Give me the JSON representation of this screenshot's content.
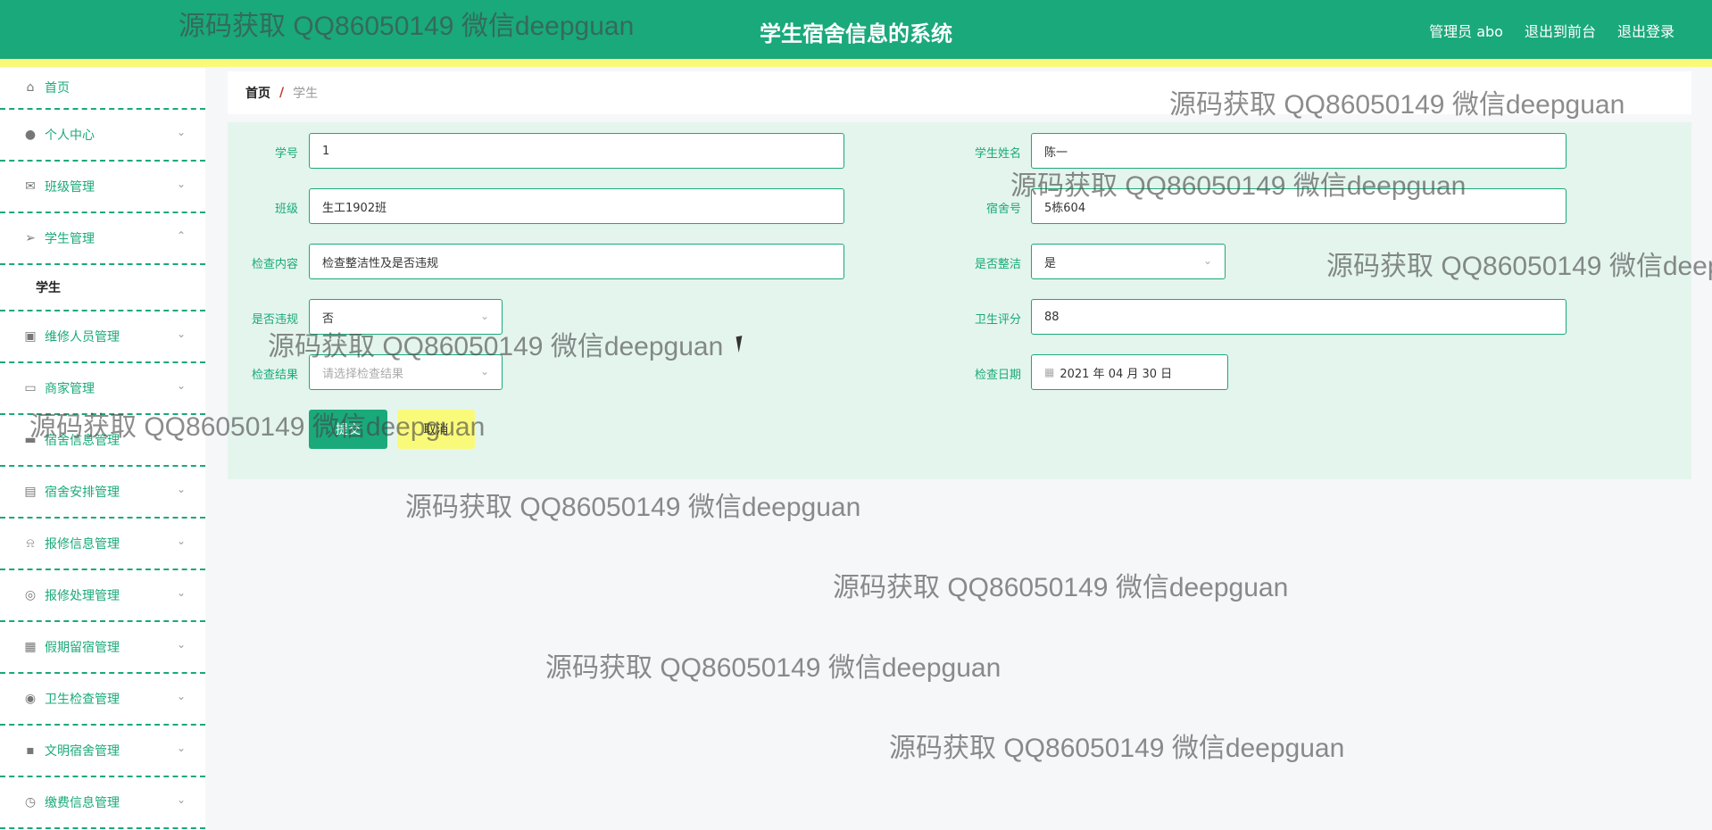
{
  "header": {
    "title": "学生宿舍信息的系统",
    "user": "管理员 abo",
    "to_front": "退出到前台",
    "logout": "退出登录"
  },
  "sidebar": {
    "items": [
      {
        "label": "首页",
        "icon": "home-icon"
      },
      {
        "label": "个人中心",
        "icon": "user-icon"
      },
      {
        "label": "班级管理",
        "icon": "mail-icon"
      },
      {
        "label": "学生管理",
        "icon": "send-icon"
      },
      {
        "label": "维修人员管理",
        "icon": "delete-icon"
      },
      {
        "label": "商家管理",
        "icon": "id-card-icon"
      },
      {
        "label": "宿舍信息管理",
        "icon": "suitcase-icon"
      },
      {
        "label": "宿舍安排管理",
        "icon": "clipboard-icon"
      },
      {
        "label": "报修信息管理",
        "icon": "bell-off-icon"
      },
      {
        "label": "报修处理管理",
        "icon": "compass-icon"
      },
      {
        "label": "假期留宿管理",
        "icon": "grid-icon"
      },
      {
        "label": "卫生检查管理",
        "icon": "lifebuoy-icon"
      },
      {
        "label": "文明宿舍管理",
        "icon": "chat-icon"
      },
      {
        "label": "缴费信息管理",
        "icon": "clock-icon"
      }
    ],
    "submenu_label": "学生"
  },
  "breadcrumb": {
    "home": "首页",
    "separator": "/",
    "current": "学生"
  },
  "form": {
    "student_no": {
      "label": "学号",
      "value": "1"
    },
    "student_name": {
      "label": "学生姓名",
      "value": "陈一"
    },
    "class": {
      "label": "班级",
      "value": "生工1902班"
    },
    "dorm_no": {
      "label": "宿舍号",
      "value": "5栋604"
    },
    "check_content": {
      "label": "检查内容",
      "value": "检查整洁性及是否违规"
    },
    "is_clean": {
      "label": "是否整洁",
      "value": "是"
    },
    "is_violation": {
      "label": "是否违规",
      "value": "否"
    },
    "hygiene_score": {
      "label": "卫生评分",
      "value": "88"
    },
    "check_result": {
      "label": "检查结果",
      "placeholder": "请选择检查结果"
    },
    "check_date": {
      "label": "检查日期",
      "value": "2021 年 04 月 30 日"
    }
  },
  "buttons": {
    "submit": "提交",
    "cancel": "取消"
  },
  "watermark": "源码获取 QQ86050149 微信deepguan",
  "colors": {
    "primary": "#1aa97a",
    "accent_yellow": "#fafa7a",
    "panel_bg": "#e4f5ee"
  }
}
